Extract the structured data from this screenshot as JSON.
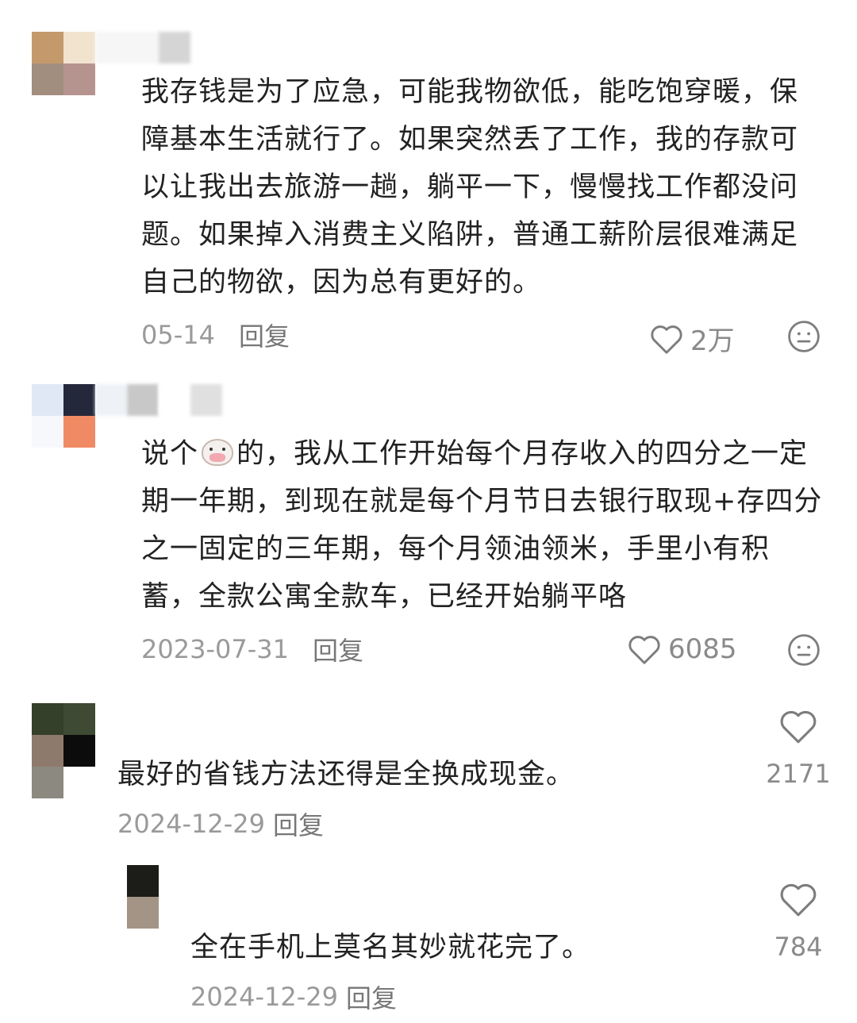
{
  "comments": [
    {
      "text": "我存钱是为了应急，可能我物欲低，能吃饱穿暖，保障基本生活就行了。如果突然丢了工作，我的存款可以让我出去旅游一趟，躺平一下，慢慢找工作都没问题。如果掉入消费主义陷阱，普通工薪阶层很难满足自己的物欲，因为总有更好的。",
      "date": "05-14",
      "reply_label": "回复",
      "likes": "2万"
    },
    {
      "text_before_emoji": "说个",
      "emoji": "cow-face-emoji",
      "text_after_emoji": "的，我从工作开始每个月存收入的四分之一定期一年期，到现在就是每个月节日去银行取现+存四分之一固定的三年期，每个月领油领米，手里小有积蓄，全款公寓全款车，已经开始躺平咯",
      "date": "2023-07-31",
      "reply_label": "回复",
      "likes": "6085"
    },
    {
      "text": "最好的省钱方法还得是全换成现金。",
      "date": "2024-12-29",
      "reply_label": "回复",
      "likes": "2171"
    },
    {
      "text": "全在手机上莫名其妙就花完了。",
      "date": "2024-12-29",
      "reply_label": "回复",
      "likes": "784"
    }
  ],
  "icons": {
    "like": "heart-outline-icon",
    "reaction": "neutral-face-icon"
  },
  "colors": {
    "text": "#222222",
    "meta": "#9a9a9a",
    "icon": "#7d7d7d"
  }
}
